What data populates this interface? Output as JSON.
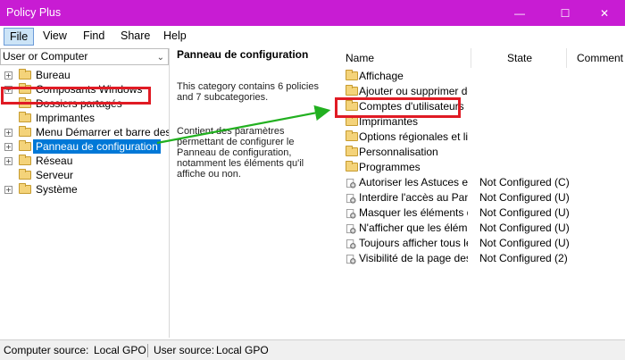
{
  "window": {
    "title": "Policy Plus",
    "min_glyph": "—",
    "max_glyph": "☐",
    "close_glyph": "✕"
  },
  "menu": [
    "File",
    "View",
    "Find",
    "Share",
    "Help"
  ],
  "scope": {
    "label": "User or Computer",
    "arrow": "⌄"
  },
  "tree": [
    {
      "label": "Bureau",
      "expander": "+"
    },
    {
      "label": "Composants Windows",
      "expander": "+"
    },
    {
      "label": "Dossiers partagés",
      "expander": ""
    },
    {
      "label": "Imprimantes",
      "expander": ""
    },
    {
      "label": "Menu Démarrer et barre des tâches",
      "expander": "+"
    },
    {
      "label": "Panneau de configuration",
      "expander": "+",
      "selected": true
    },
    {
      "label": "Réseau",
      "expander": "+"
    },
    {
      "label": "Serveur",
      "expander": ""
    },
    {
      "label": "Système",
      "expander": "+"
    }
  ],
  "description": {
    "title": "Panneau de configuration",
    "summary": "This category contains 6 policies and 7 subcategories.",
    "body": "Contient des paramètres permettant de configurer le Panneau de configuration, notamment les éléments qu'il affiche ou non."
  },
  "list": {
    "columns": {
      "name": "Name",
      "state": "State",
      "comment": "Comment"
    },
    "folders": [
      "Affichage",
      "Ajouter ou supprimer de...",
      "Comptes d'utilisateurs",
      "Imprimantes",
      "Options régionales et lin...",
      "Personnalisation",
      "Programmes"
    ],
    "policies": [
      {
        "name": "Autoriser les Astuces en...",
        "state": "Not Configured (C)"
      },
      {
        "name": "Interdire l'accès au Pan...",
        "state": "Not Configured (U)"
      },
      {
        "name": "Masquer les éléments d...",
        "state": "Not Configured (U)"
      },
      {
        "name": "N'afficher que les éléme...",
        "state": "Not Configured (U)"
      },
      {
        "name": "Toujours afficher tous le...",
        "state": "Not Configured (U)"
      },
      {
        "name": "Visibilité de la page des ...",
        "state": "Not Configured (2)"
      }
    ]
  },
  "status": {
    "computer_label": "Computer source:",
    "computer_value": "Local GPO",
    "user_label": "User source:",
    "user_value": "Local GPO"
  },
  "colors": {
    "titlebar": "#c81cd3",
    "selection": "#0078d7",
    "highlight_box": "#e01b24",
    "arrow": "#22b020"
  }
}
